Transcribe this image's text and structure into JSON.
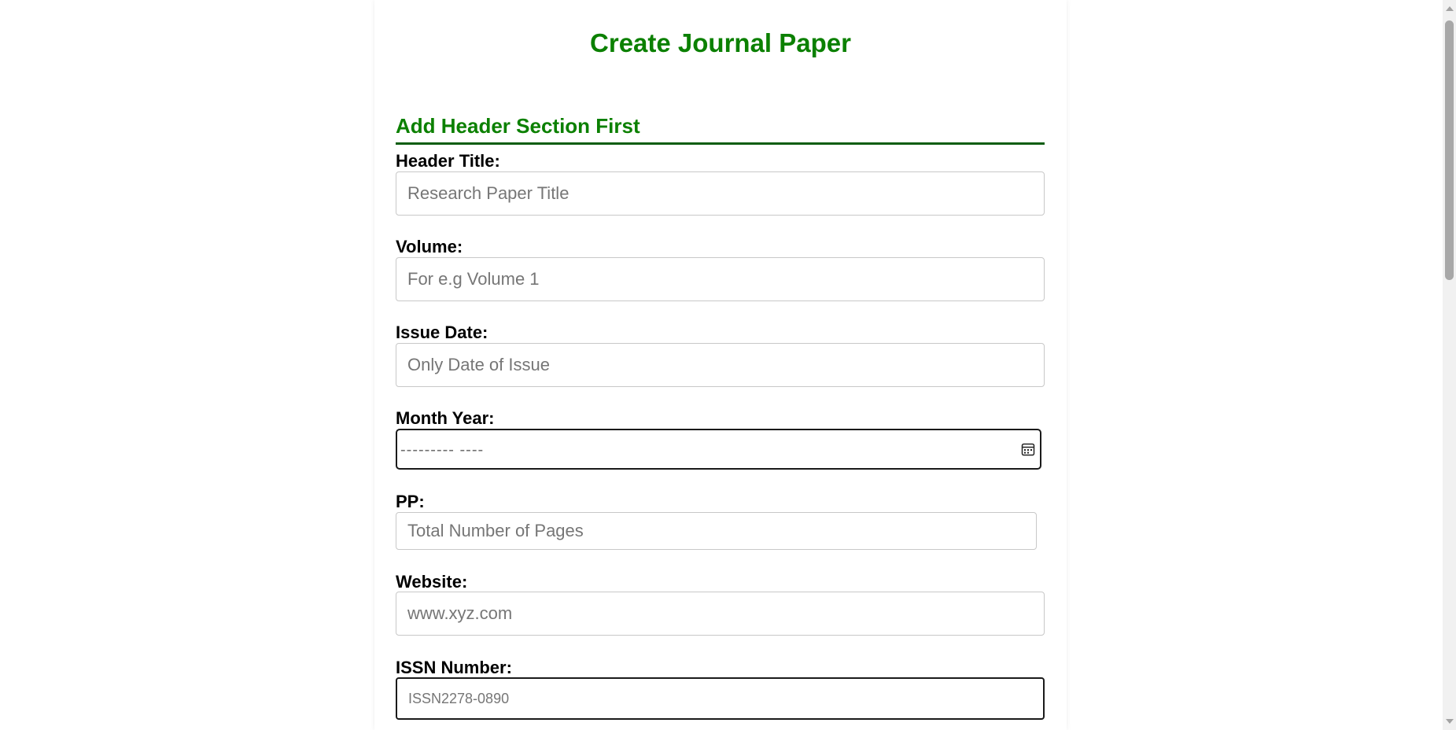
{
  "page": {
    "title": "Create Journal Paper",
    "section_title": "Add Header Section First"
  },
  "fields": {
    "header_title": {
      "label": "Header Title:",
      "placeholder": "Research Paper Title",
      "value": ""
    },
    "volume": {
      "label": "Volume:",
      "placeholder": "For e.g Volume 1",
      "value": ""
    },
    "issue_date": {
      "label": "Issue Date:",
      "placeholder": "Only Date of Issue",
      "value": ""
    },
    "month_year": {
      "label": "Month Year:",
      "mask": "---------  ----",
      "icon": "calendar-icon"
    },
    "pp": {
      "label": "PP:",
      "placeholder": "Total Number of Pages",
      "value": ""
    },
    "website": {
      "label": "Website:",
      "placeholder": "www.xyz.com",
      "value": ""
    },
    "issn": {
      "label": "ISSN Number:",
      "placeholder": "ISSN2278-0890",
      "value": ""
    }
  },
  "colors": {
    "accent_green": "#0b8000",
    "divider_green": "#0b5d10"
  }
}
